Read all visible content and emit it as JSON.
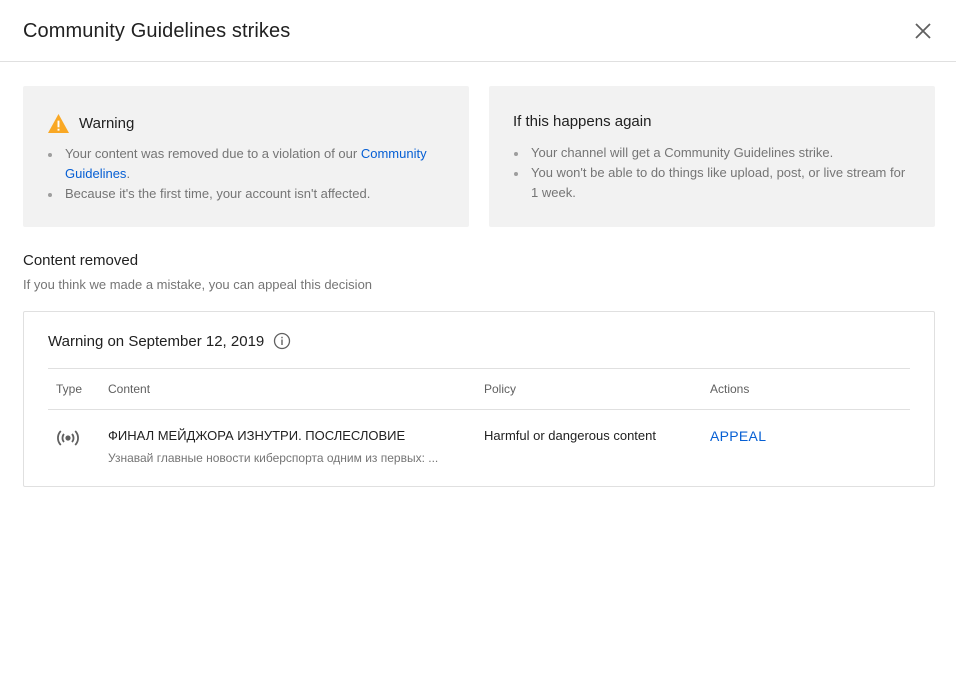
{
  "dialog": {
    "title": "Community Guidelines strikes",
    "close_icon": "close-icon"
  },
  "warning_card": {
    "icon": "warning-triangle-icon",
    "icon_color": "#f9a825",
    "title": "Warning",
    "bullet1_text": "Your content was removed due to a violation of our ",
    "bullet1_link": "Community Guidelines",
    "bullet1_end": ".",
    "bullet2": "Because it's the first time, your account isn't affected."
  },
  "again_card": {
    "title": "If this happens again",
    "bullets": [
      "Your channel will get a Community Guidelines strike.",
      "You won't be able to do things like upload, post, or live stream for 1 week."
    ]
  },
  "content_removed": {
    "title": "Content removed",
    "subtitle": "If you think we made a mistake, you can appeal this decision"
  },
  "strike": {
    "title": "Warning on September 12, 2019",
    "info_icon": "info-icon",
    "columns": [
      "Type",
      "Content",
      "Policy",
      "Actions"
    ],
    "row": {
      "type_icon": "live-stream-icon",
      "video_title": "ФИНАЛ МЕЙДЖОРА ИЗНУТРИ. ПОСЛЕСЛОВИЕ",
      "video_desc": "Узнавай главные новости киберспорта одним из первых: ...",
      "policy": "Harmful or dangerous content",
      "action": "APPEAL"
    }
  },
  "colors": {
    "link": "#065fd4",
    "card_bg": "#f2f2f2",
    "muted_text": "#757575"
  }
}
